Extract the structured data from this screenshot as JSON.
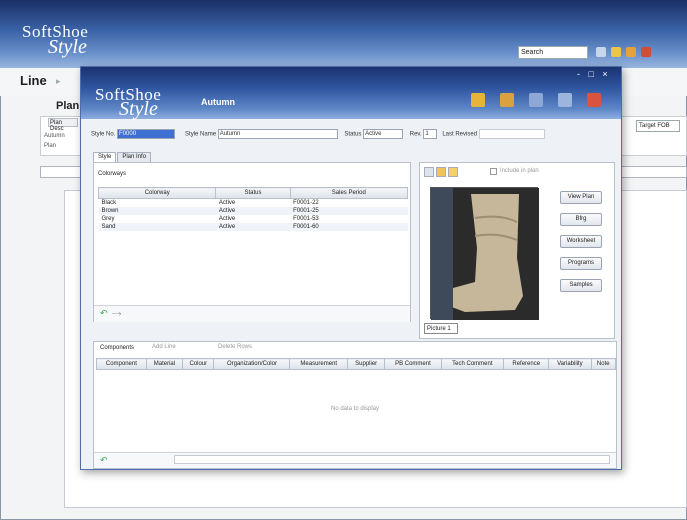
{
  "background": {
    "logo_top": "SoftShoe",
    "logo_bottom": "Style",
    "search_placeholder": "Search",
    "line_label": "Line",
    "plan_label": "Plan",
    "tab_label": "Plan Desc",
    "row1": "Autumn",
    "row2": "Plan",
    "target": "Target FOB"
  },
  "dialog": {
    "logo_top": "SoftShoe",
    "logo_bottom": "Style",
    "title": "Autumn",
    "window_controls": "- □ ×",
    "fields": {
      "style_no_label": "Style No.",
      "style_no_value": "F0000",
      "style_name_label": "Style Name",
      "style_name_value": "Autumn",
      "status_label": "Status",
      "status_value": "Active",
      "rev_label": "Rev.",
      "rev_value": "1",
      "last_revised_label": "Last Revised"
    },
    "tabs": [
      "Style",
      "Plan Info"
    ],
    "colorways": {
      "title": "Colorways",
      "headers": [
        "Colorway",
        "Status",
        "Sales Period"
      ],
      "rows": [
        [
          "Black",
          "Active",
          "F0001-22"
        ],
        [
          "Brown",
          "Active",
          "F0001-25"
        ],
        [
          "Grey",
          "Active",
          "F0001-53"
        ],
        [
          "Sand",
          "Active",
          "F0001-60"
        ]
      ]
    },
    "image": {
      "checkbox_label": "Include in plan",
      "caption": "Picture 1"
    },
    "side_buttons": [
      "View Plan",
      "Bfrg",
      "Worksheet",
      "Programs",
      "Samples"
    ],
    "components": {
      "title": "Components",
      "add_label": "Add Line",
      "delete_label": "Delete Rows",
      "headers": [
        "Component",
        "Material",
        "Colour",
        "Organization/Color",
        "Measurement",
        "Supplier",
        "PB Comment",
        "Tech Comment",
        "Reference",
        "Variability",
        "Note"
      ],
      "empty_text": "No data to display"
    }
  }
}
